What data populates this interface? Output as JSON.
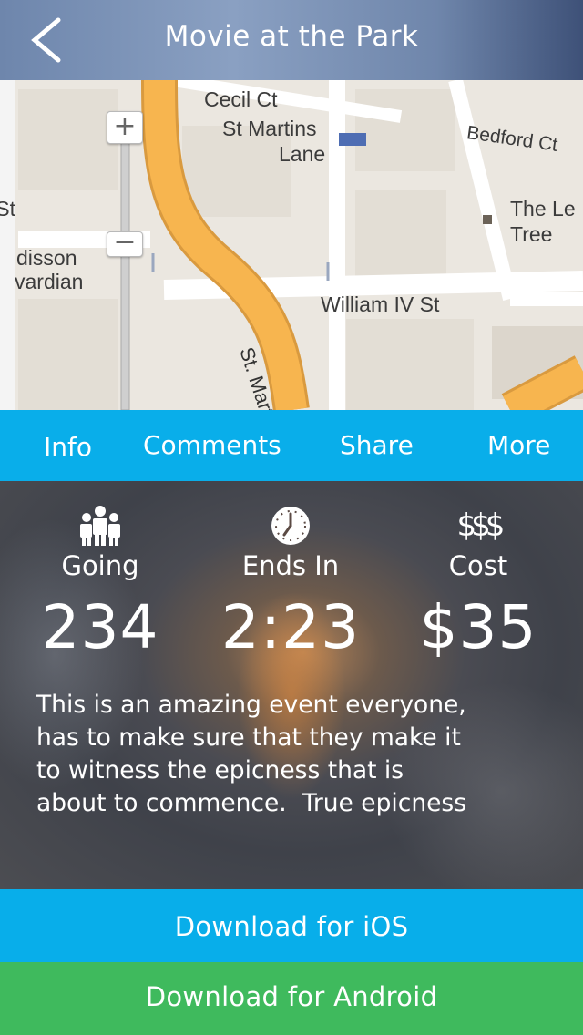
{
  "header": {
    "title": "Movie at the Park",
    "back_icon": "chevron-left-icon"
  },
  "map": {
    "zoom_in_label": "+",
    "zoom_out_label": "−",
    "labels": {
      "cecil": "Cecil Ct",
      "stmartins": "St Martins",
      "lane": "Lane",
      "bedford": "Bedford Ct",
      "the_le": "The Le",
      "tree": "Tree",
      "st": "St",
      "disson": "disson",
      "vardian": "vardian",
      "william": "William IV St",
      "st_martin_road": "St. Martin"
    }
  },
  "tabs": {
    "info": "Info",
    "comments": "Comments",
    "share": "Share",
    "more": "More"
  },
  "stats": {
    "going": {
      "label": "Going",
      "value": "234",
      "icon": "people-icon"
    },
    "ends": {
      "label": "Ends In",
      "value": "2:23",
      "icon": "clock-icon"
    },
    "cost": {
      "label": "Cost",
      "value": "$35",
      "icon": "dollars-icon",
      "icon_text": "$$$"
    }
  },
  "description": {
    "line1": "This is an amazing event everyone,",
    "line2": "has to make sure that they make it",
    "line3": "to witness the epicness that is",
    "line4": "about to commence.  True epicness"
  },
  "buttons": {
    "ios": "Download for iOS",
    "android": "Download for Android"
  },
  "colors": {
    "tab_bar": "#09aeea",
    "ios_button": "#08aeea",
    "android_button": "#3fba5d",
    "road": "#f7b54f"
  }
}
